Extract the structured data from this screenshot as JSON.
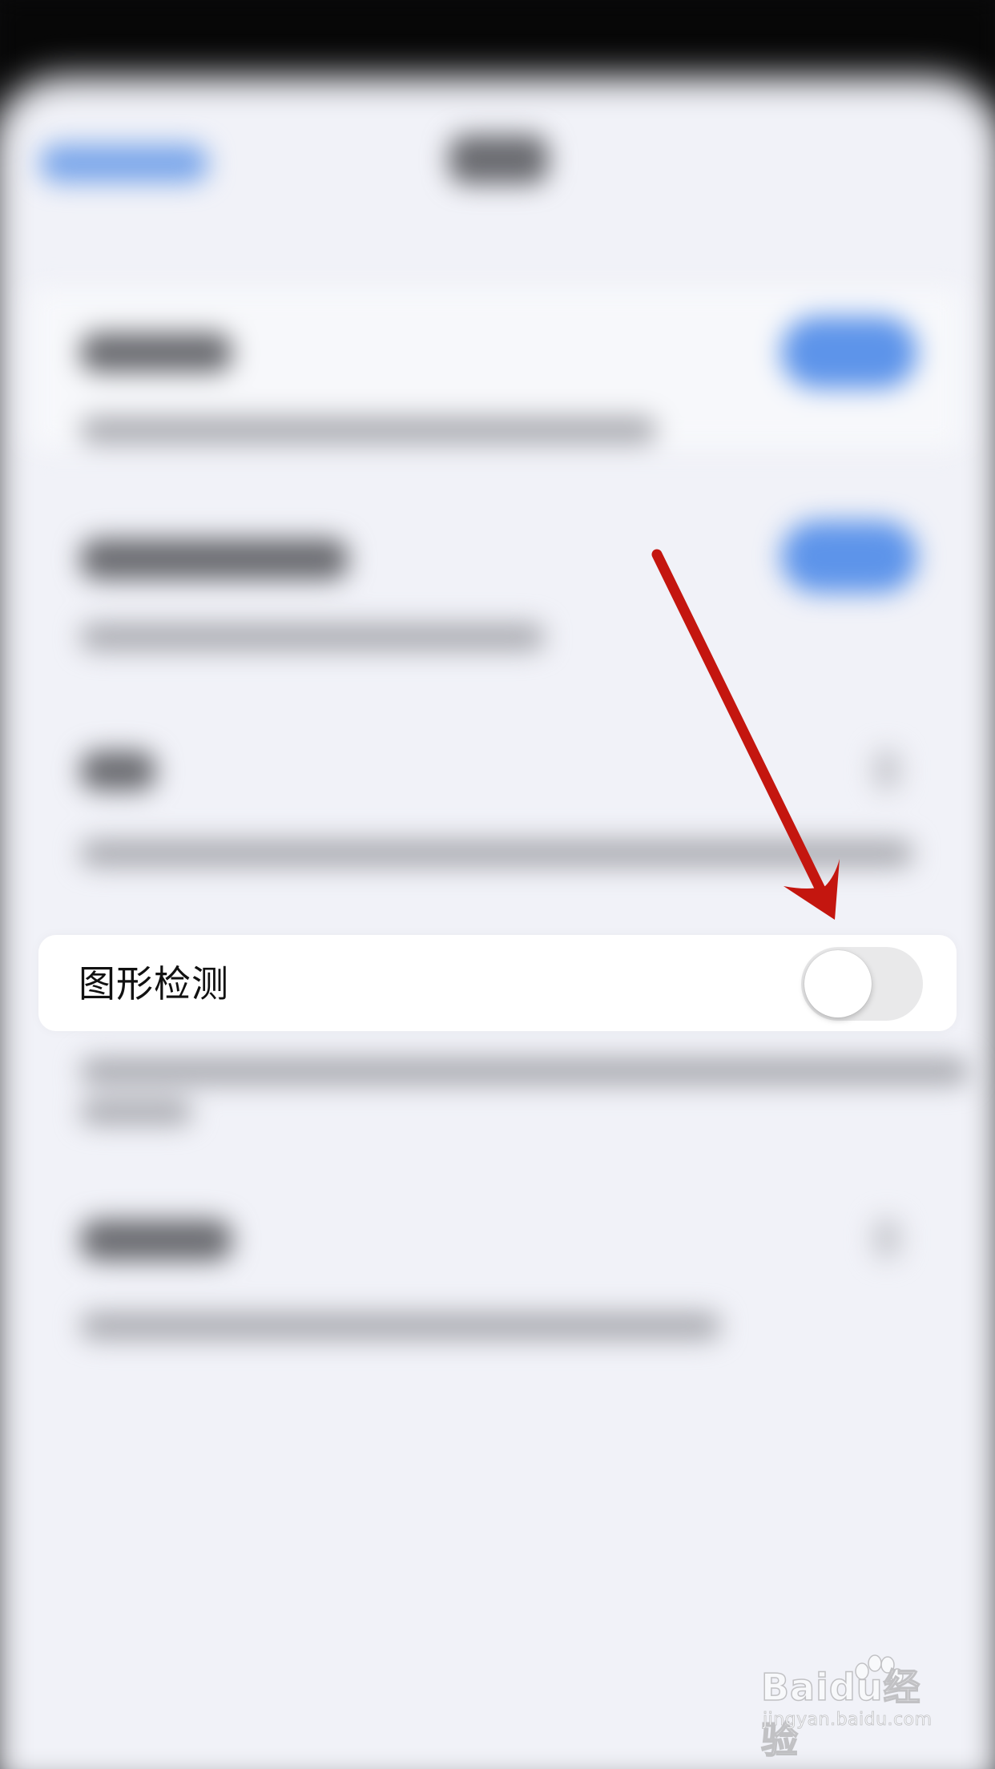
{
  "setting": {
    "label": "图形检测",
    "toggle_state": "off"
  },
  "colors": {
    "page_background": "#f1f2f8",
    "card_background": "#ffffff",
    "toggle_off_track": "#e9e9ea",
    "blurred_toggle_on": "#5d94ea",
    "annotation_arrow": "#c4160f"
  },
  "annotation": {
    "type": "arrow",
    "points_to": "toggle"
  },
  "watermark": {
    "brand": "Baidu经验",
    "url": "jingyan.baidu.com"
  }
}
